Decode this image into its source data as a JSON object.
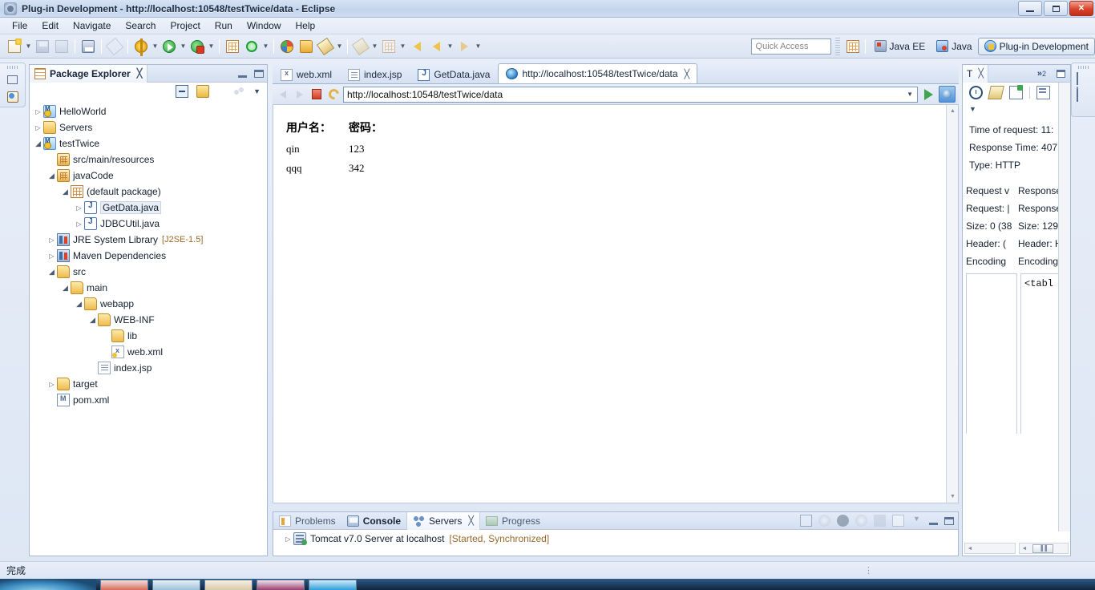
{
  "window": {
    "title": "Plug-in Development - http://localhost:10548/testTwice/data - Eclipse",
    "icon": "eclipse-icon",
    "minimize_label": "Minimize",
    "maximize_label": "Maximize",
    "close_label": "✕"
  },
  "menubar": {
    "items": [
      "File",
      "Edit",
      "Navigate",
      "Search",
      "Project",
      "Run",
      "Window",
      "Help"
    ]
  },
  "toolbar": {
    "quick_access_placeholder": "Quick Access",
    "perspectives": [
      {
        "label": "Java EE",
        "icon": "java-ee-perspective-icon",
        "active": false
      },
      {
        "label": "Java",
        "icon": "java-perspective-icon",
        "active": false
      },
      {
        "label": "Plug-in Development",
        "icon": "plugin-development-perspective-icon",
        "active": true
      }
    ],
    "open_perspective_label": "Open Perspective"
  },
  "package_explorer": {
    "tab_label": "Package Explorer",
    "close_glyph": "╳",
    "tree": [
      {
        "indent": 0,
        "twisty": "closed",
        "icon": "java-project-icon",
        "label": "HelloWorld",
        "sub": ""
      },
      {
        "indent": 0,
        "twisty": "closed",
        "icon": "folder-icon",
        "label": "Servers",
        "sub": ""
      },
      {
        "indent": 0,
        "twisty": "open",
        "icon": "java-project-icon",
        "label": "testTwice",
        "sub": ""
      },
      {
        "indent": 1,
        "twisty": "none",
        "icon": "source-folder-icon",
        "label": "src/main/resources",
        "sub": ""
      },
      {
        "indent": 1,
        "twisty": "open",
        "icon": "source-folder-icon",
        "label": "javaCode",
        "sub": ""
      },
      {
        "indent": 2,
        "twisty": "open",
        "icon": "package-icon",
        "label": "(default package)",
        "sub": ""
      },
      {
        "indent": 3,
        "twisty": "closed",
        "icon": "java-file-icon",
        "label": "GetData.java",
        "sub": "",
        "selected": true
      },
      {
        "indent": 3,
        "twisty": "closed",
        "icon": "java-file-icon",
        "label": "JDBCUtil.java",
        "sub": ""
      },
      {
        "indent": 1,
        "twisty": "closed",
        "icon": "library-icon",
        "label": "JRE System Library",
        "sub": "[J2SE-1.5]"
      },
      {
        "indent": 1,
        "twisty": "closed",
        "icon": "library-icon",
        "label": "Maven Dependencies",
        "sub": ""
      },
      {
        "indent": 1,
        "twisty": "open",
        "icon": "folder-icon",
        "label": "src",
        "sub": ""
      },
      {
        "indent": 2,
        "twisty": "open",
        "icon": "folder-icon",
        "label": "main",
        "sub": ""
      },
      {
        "indent": 3,
        "twisty": "open",
        "icon": "folder-icon",
        "label": "webapp",
        "sub": ""
      },
      {
        "indent": 4,
        "twisty": "open",
        "icon": "folder-icon",
        "label": "WEB-INF",
        "sub": ""
      },
      {
        "indent": 5,
        "twisty": "none",
        "icon": "folder-icon",
        "label": "lib",
        "sub": ""
      },
      {
        "indent": 5,
        "twisty": "none",
        "icon": "xml-file-icon",
        "label": "web.xml",
        "sub": ""
      },
      {
        "indent": 4,
        "twisty": "none",
        "icon": "jsp-file-icon",
        "label": "index.jsp",
        "sub": ""
      },
      {
        "indent": 1,
        "twisty": "closed",
        "icon": "folder-icon",
        "label": "target",
        "sub": ""
      },
      {
        "indent": 1,
        "twisty": "none",
        "icon": "maven-pom-icon",
        "label": "pom.xml",
        "sub": ""
      }
    ]
  },
  "editor": {
    "tabs": [
      {
        "label": "web.xml",
        "icon": "xml-file-icon",
        "active": false,
        "closable": false
      },
      {
        "label": "index.jsp",
        "icon": "jsp-file-icon",
        "active": false,
        "closable": false
      },
      {
        "label": "GetData.java",
        "icon": "java-file-icon",
        "active": false,
        "closable": false
      },
      {
        "label": "http://localhost:10548/testTwice/data",
        "icon": "web-browser-icon",
        "active": true,
        "closable": true
      }
    ],
    "close_glyph": "╳",
    "browser": {
      "url_value": "http://localhost:10548/testTwice/data",
      "back_label": "Back",
      "forward_label": "Forward",
      "stop_label": "Stop",
      "refresh_label": "Refresh",
      "go_label": "Go",
      "open_external_label": "Open in external browser"
    },
    "page": {
      "headers": [
        "用户名：",
        "密码："
      ],
      "rows": [
        [
          "qin",
          "123"
        ],
        [
          "qqq",
          "342"
        ]
      ]
    }
  },
  "bottom_panel": {
    "tabs": [
      {
        "label": "Problems",
        "icon": "problems-icon",
        "active": false
      },
      {
        "label": "Console",
        "icon": "console-icon",
        "active": false
      },
      {
        "label": "Servers",
        "icon": "servers-icon",
        "active": true
      },
      {
        "label": "Progress",
        "icon": "progress-icon",
        "active": false
      }
    ],
    "close_glyph": "╳",
    "server": {
      "name": "Tomcat v7.0 Server at localhost",
      "status": "[Started, Synchronized]",
      "icon": "server-icon"
    }
  },
  "right_panel": {
    "tab_label": "T",
    "close_glyph": "╳",
    "overflow_count": "2",
    "overflow_glyph": "»",
    "info": [
      "Time of request: 11:",
      "Response Time: 407",
      "Type: HTTP"
    ],
    "columns": {
      "left": [
        "Request v",
        "Request: |",
        "Size: 0 (38",
        "Header: (",
        "Encoding"
      ],
      "right": [
        "Response",
        "Response",
        "Size: 129 (",
        "Header: H",
        "Encoding"
      ]
    },
    "code_snippet": "<tabl",
    "hscroll_left_arrow": "◄",
    "hscroll_right_thumb": "▐▐"
  },
  "statusbar": {
    "message": "完成"
  },
  "colors": {
    "accent": "#4f93dd",
    "title_bar": "#c3d4ec",
    "close_button": "#d9432a",
    "status_running": "#9a6a2a",
    "panel_bg": "#ffffff"
  }
}
